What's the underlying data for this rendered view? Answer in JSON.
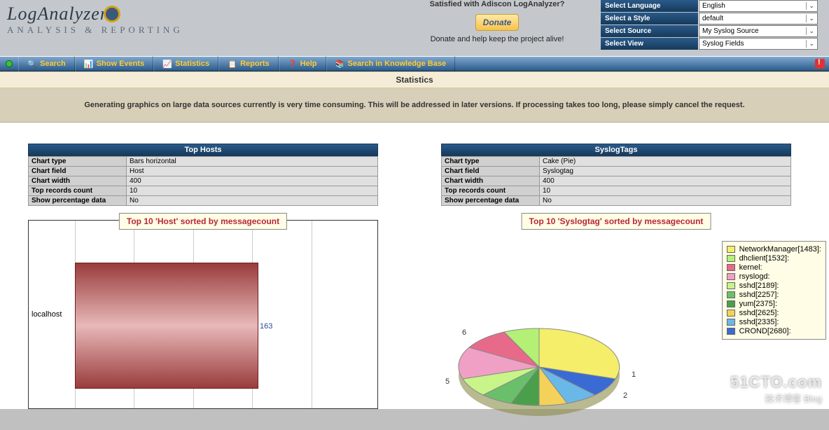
{
  "header": {
    "logo_main": "LogAnalyzer",
    "logo_sub": "ANALYSIS & REPORTING",
    "donate_question": "Satisfied with Adiscon LogAnalyzer?",
    "donate_button": "Donate",
    "donate_help": "Donate and help keep the project alive!",
    "selects": [
      {
        "label": "Select Language",
        "value": "English"
      },
      {
        "label": "Select a Style",
        "value": "default"
      },
      {
        "label": "Select Source",
        "value": "My Syslog Source"
      },
      {
        "label": "Select View",
        "value": "Syslog Fields"
      }
    ]
  },
  "menu": {
    "items": [
      {
        "icon": "🔍",
        "label": "Search"
      },
      {
        "icon": "📊",
        "label": "Show Events"
      },
      {
        "icon": "📈",
        "label": "Statistics"
      },
      {
        "icon": "📋",
        "label": "Reports"
      },
      {
        "icon": "❓",
        "label": "Help"
      },
      {
        "icon": "📚",
        "label": "Search in Knowledge Base"
      }
    ]
  },
  "page": {
    "title": "Statistics",
    "notice": "Generating graphics on large data sources currently is very time consuming. This will be addressed in later versions. If processing takes too long, please simply cancel the request."
  },
  "panels": {
    "left": {
      "title": "Top Hosts",
      "meta": [
        {
          "k": "Chart type",
          "v": "Bars horizontal"
        },
        {
          "k": "Chart field",
          "v": "Host"
        },
        {
          "k": "Chart width",
          "v": "400"
        },
        {
          "k": "Top records count",
          "v": "10"
        },
        {
          "k": "Show percentage data",
          "v": "No"
        }
      ],
      "caption": "Top 10 'Host' sorted by messagecount"
    },
    "right": {
      "title": "SyslogTags",
      "meta": [
        {
          "k": "Chart type",
          "v": "Cake (Pie)"
        },
        {
          "k": "Chart field",
          "v": "Syslogtag"
        },
        {
          "k": "Chart width",
          "v": "400"
        },
        {
          "k": "Top records count",
          "v": "10"
        },
        {
          "k": "Show percentage data",
          "v": "No"
        }
      ],
      "caption": "Top 10 'Syslogtag' sorted by messagecount"
    }
  },
  "chart_data": [
    {
      "type": "bar",
      "orientation": "horizontal",
      "title": "Top 10 'Host' sorted by messagecount",
      "xlabel": "",
      "ylabel": "",
      "categories": [
        "localhost"
      ],
      "values": [
        163
      ],
      "xlim": [
        0,
        200
      ]
    },
    {
      "type": "pie",
      "title": "Top 10 'Syslogtag' sorted by messagecount",
      "series": [
        {
          "name": "NetworkManager[1483]:",
          "color": "#f4ee6a"
        },
        {
          "name": "dhclient[1532]:",
          "color": "#b4f075"
        },
        {
          "name": "kernel:",
          "color": "#e86a8a"
        },
        {
          "name": "rsyslogd:",
          "color": "#f0a0c4"
        },
        {
          "name": "sshd[2189]:",
          "color": "#c8f48a"
        },
        {
          "name": "sshd[2257]:",
          "color": "#6ac06a"
        },
        {
          "name": "yum[2375]:",
          "color": "#4aa04a"
        },
        {
          "name": "sshd[2625]:",
          "color": "#f4d25a"
        },
        {
          "name": "sshd[2335]:",
          "color": "#6ab8e8"
        },
        {
          "name": "CROND[2680]:",
          "color": "#3a6ad4"
        }
      ],
      "visible_labels": [
        "6",
        "5",
        "1",
        "2"
      ]
    }
  ],
  "watermark": {
    "line1": "51CTO.com",
    "line2": "技术博客  Blog"
  }
}
